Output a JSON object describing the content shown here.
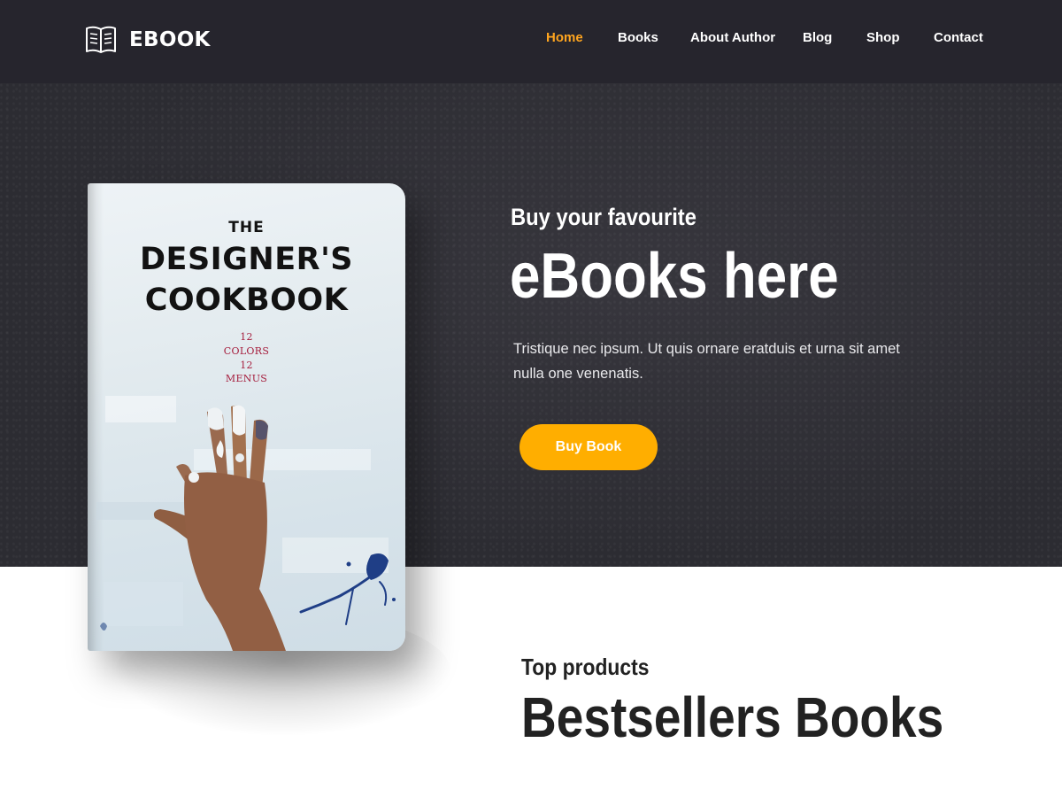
{
  "brand": {
    "name": "EBOOK",
    "icon": "open-book-icon"
  },
  "nav": {
    "items": [
      {
        "label": "Home",
        "active": true
      },
      {
        "label": "Books",
        "active": false
      },
      {
        "label": "About Author",
        "active": false
      },
      {
        "label": "Blog",
        "active": false
      },
      {
        "label": "Shop",
        "active": false
      },
      {
        "label": "Contact",
        "active": false
      }
    ]
  },
  "hero": {
    "kicker": "Buy your favourite",
    "title": "eBooks here",
    "text": "Tristique nec ipsum. Ut quis ornare eratduis et urna sit amet nulla one venenatis.",
    "button_label": "Buy Book"
  },
  "book": {
    "line_the": "THE",
    "line_1": "DESIGNER'S",
    "line_2": "COOKBOOK",
    "sub": [
      "12",
      "COLORS",
      "12",
      "MENUS"
    ]
  },
  "bestsellers": {
    "kicker": "Top products",
    "title": "Bestsellers Books"
  },
  "colors": {
    "header_bg": "#26252d",
    "hero_bg": "#303036",
    "accent": "#ffa51f",
    "button": "#ffae00",
    "book_subtitle": "#a51d3c"
  }
}
